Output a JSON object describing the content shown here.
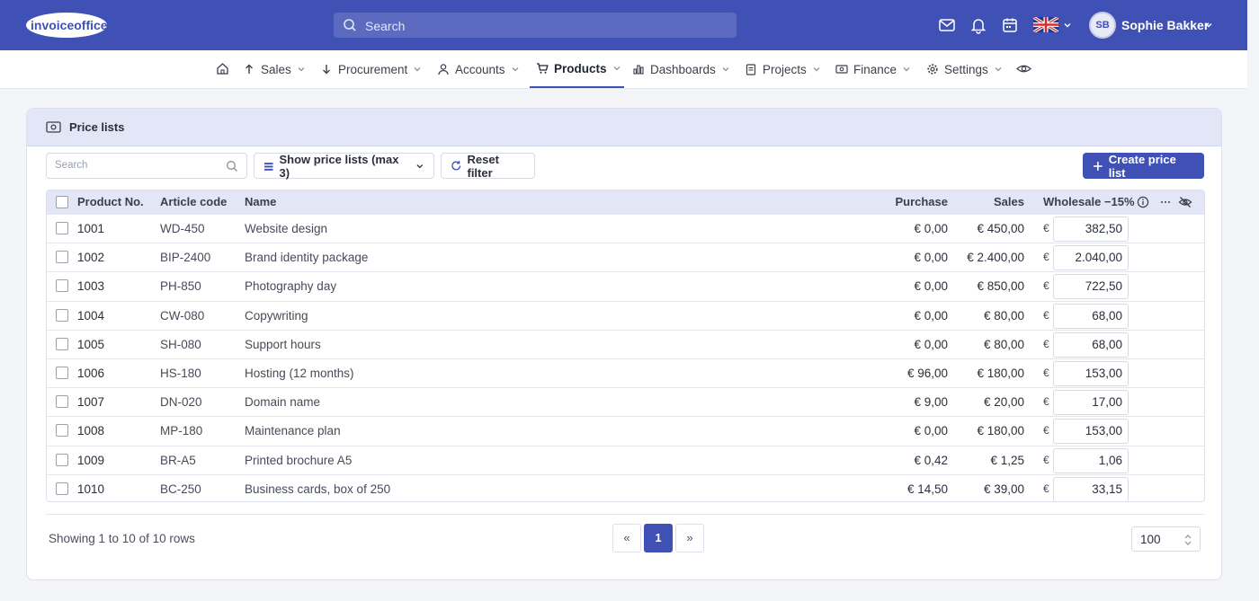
{
  "header": {
    "logo_text": "invoiceoffice",
    "search_placeholder": "Search",
    "user_initials": "SB",
    "user_name": "Sophie Bakker"
  },
  "nav": {
    "items": [
      {
        "label": "Sales"
      },
      {
        "label": "Procurement"
      },
      {
        "label": "Accounts"
      },
      {
        "label": "Products",
        "active": true
      },
      {
        "label": "Dashboards"
      },
      {
        "label": "Projects"
      },
      {
        "label": "Finance"
      },
      {
        "label": "Settings"
      }
    ]
  },
  "card": {
    "title": "Price lists",
    "search_placeholder": "Search",
    "show_lists_label": "Show price lists (max 3)",
    "reset_label": "Reset filter",
    "create_label": "Create price list"
  },
  "table": {
    "columns": {
      "product_no": "Product No.",
      "article_code": "Article code",
      "name": "Name",
      "purchase": "Purchase",
      "sales": "Sales",
      "wholesale": "Wholesale −15%"
    },
    "currency_symbol": "€",
    "rows": [
      {
        "no": "1001",
        "code": "WD-450",
        "name": "Website design",
        "purchase": "€ 0,00",
        "sales": "€ 450,00",
        "wholesale": "382,50"
      },
      {
        "no": "1002",
        "code": "BIP-2400",
        "name": "Brand identity package",
        "purchase": "€ 0,00",
        "sales": "€ 2.400,00",
        "wholesale": "2.040,00"
      },
      {
        "no": "1003",
        "code": "PH-850",
        "name": "Photography day",
        "purchase": "€ 0,00",
        "sales": "€ 850,00",
        "wholesale": "722,50"
      },
      {
        "no": "1004",
        "code": "CW-080",
        "name": "Copywriting",
        "purchase": "€ 0,00",
        "sales": "€ 80,00",
        "wholesale": "68,00"
      },
      {
        "no": "1005",
        "code": "SH-080",
        "name": "Support hours",
        "purchase": "€ 0,00",
        "sales": "€ 80,00",
        "wholesale": "68,00"
      },
      {
        "no": "1006",
        "code": "HS-180",
        "name": "Hosting (12 months)",
        "purchase": "€ 96,00",
        "sales": "€ 180,00",
        "wholesale": "153,00"
      },
      {
        "no": "1007",
        "code": "DN-020",
        "name": "Domain name",
        "purchase": "€ 9,00",
        "sales": "€ 20,00",
        "wholesale": "17,00"
      },
      {
        "no": "1008",
        "code": "MP-180",
        "name": "Maintenance plan",
        "purchase": "€ 0,00",
        "sales": "€ 180,00",
        "wholesale": "153,00"
      },
      {
        "no": "1009",
        "code": "BR-A5",
        "name": "Printed brochure A5",
        "purchase": "€ 0,42",
        "sales": "€ 1,25",
        "wholesale": "1,06"
      },
      {
        "no": "1010",
        "code": "BC-250",
        "name": "Business cards, box of 250",
        "purchase": "€ 14,50",
        "sales": "€ 39,00",
        "wholesale": "33,15"
      }
    ]
  },
  "footer": {
    "showing_text": "Showing 1 to 10 of 10 rows",
    "prev_label": "«",
    "current_page": "1",
    "next_label": "»",
    "page_size": "100"
  },
  "colors": {
    "brand": "#3f51b5",
    "header_tint": "#e3e6f7"
  }
}
